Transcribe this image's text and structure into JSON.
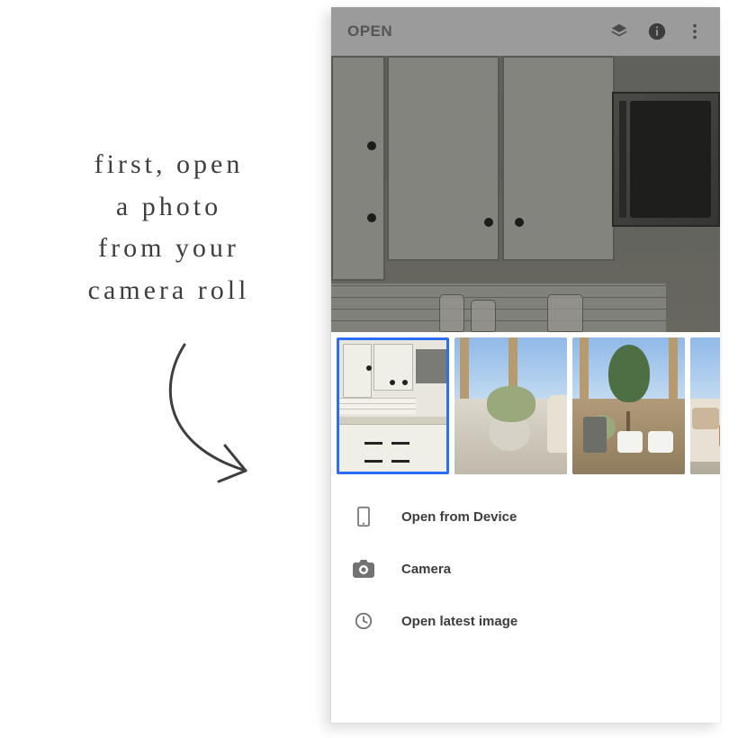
{
  "caption": {
    "line1": "first, open",
    "line2": "a photo",
    "line3": "from your",
    "line4": "camera roll"
  },
  "toolbar": {
    "title": "OPEN",
    "icons": {
      "undo": "undo-layers-icon",
      "info": "info-icon",
      "more": "more-vert-icon"
    }
  },
  "thumbnails": [
    {
      "name": "kitchen-photo",
      "selected": true
    },
    {
      "name": "porch-basket-photo",
      "selected": false
    },
    {
      "name": "porch-plants-photo",
      "selected": false
    },
    {
      "name": "porch-chair-dog-photo",
      "selected": false
    }
  ],
  "options": [
    {
      "icon": "device-icon",
      "label": "Open from Device"
    },
    {
      "icon": "camera-icon",
      "label": "Camera"
    },
    {
      "icon": "clock-icon",
      "label": "Open latest image"
    }
  ]
}
